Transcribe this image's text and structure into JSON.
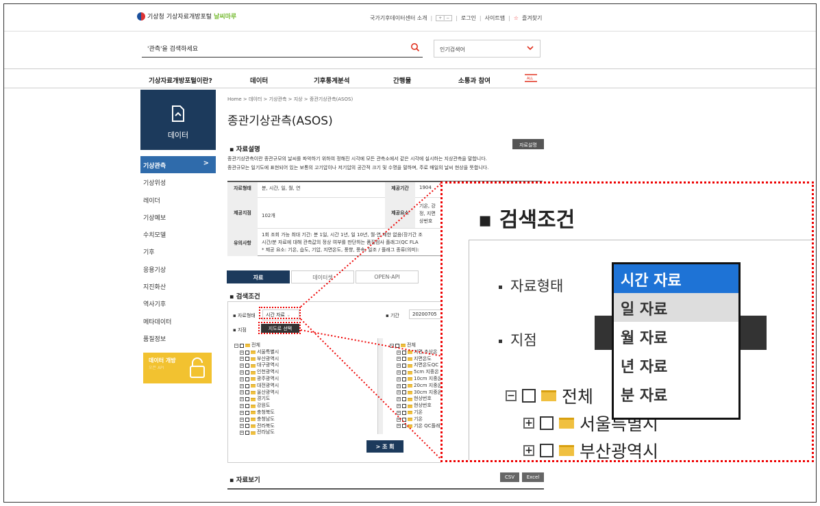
{
  "header": {
    "logo_org": "기상청",
    "logo_text": "기상자료개방포털",
    "logo_sub": "날씨마루",
    "toplinks": [
      "국가기후데이터센터 소개",
      "로그인",
      "사이트맵",
      "즐겨찾기"
    ],
    "search_placeholder": "'관측'을 검색하세요",
    "popular_label": "인기검색어"
  },
  "gnb": {
    "items": [
      "기상자료개방포털이란?",
      "데이터",
      "기후통계분석",
      "간행물",
      "소통과 참여"
    ],
    "all_label": "ALL"
  },
  "sidebar": {
    "title": "데이터",
    "items": [
      "기상관측",
      "기상위성",
      "레이더",
      "기상예보",
      "수치모델",
      "기후",
      "응용기상",
      "지진화산",
      "역사기후",
      "메타데이터",
      "품질정보"
    ],
    "banner_title": "데이터 개방",
    "banner_sub": "오픈 API"
  },
  "main": {
    "breadcrumb": "Home > 데이터 > 기상관측 > 지상 > 종관기상관측(ASOS)",
    "title": "종관기상관측(ASOS)",
    "desc_title": "자료설명",
    "desc_button": "자료설명",
    "desc_line1": "종관기상관측이란 종관규모의 날씨를 파악하기 위하여 정해진 시각에 모든 관측소에서 같은 시각에 실시하는 지상관측을 말합니다.",
    "desc_line2": "종관규모는 일기도에 표현되어 있는 보통의 고기압이나 저기압의 공간적 크기 및 수명을 말하며, 주로 매일의 날씨 현상을 뜻합니다.",
    "info": {
      "type_label": "자료형태",
      "type_value": "분, 시간, 일, 월, 연",
      "period_label": "제공기간",
      "period_value": "1904",
      "station_label": "제공지점",
      "station_value": "102개",
      "elements_label": "제공요소",
      "elements_value": "기온, 강",
      "elements_value2": "정, 지면",
      "elements_value3": "상번호",
      "note_label": "유의사항",
      "note_line1": "1회 조회 가능 최대 기간: 분 1일, 시간 1년, 일 10년, 월·연 제한 없음(장기간 조",
      "note_line2": "시간/분 자료에 대해 관측값의 정상 여부를 판단하는 품질검사 플래그(QC FLA",
      "note_line3": "* 제공 요소: 기온, 습도, 기압, 지면온도, 풍향, 풍속, 일조 / 플래그 종류(의미):"
    },
    "tabs": [
      "자료",
      "데이터셋",
      "OPEN-API"
    ],
    "search_title": "검색조건",
    "type_label": "자료형태",
    "type_value": "시간 자료",
    "period_label": "기간",
    "period_value": "20200705",
    "station_label": "지점",
    "map_button": "지도로 선택",
    "tree_left": [
      "전체",
      "서울특별시",
      "부산광역시",
      "대구광역시",
      "인천광역시",
      "광주광역시",
      "대전광역시",
      "울산광역시",
      "경기도",
      "강원도",
      "충청북도",
      "충청남도",
      "전라북도",
      "전라남도"
    ],
    "tree_right": [
      "전체",
      "지면,초상온",
      "지면온도",
      "지면온도QC",
      "5cm 지중온",
      "10cm 지중온",
      "20cm 지중온",
      "30cm 지중온",
      "현상번호",
      "현상번호",
      "기온",
      "기온",
      "기온 QC플래그"
    ],
    "query_button": "> 조 회",
    "view_title": "자료보기",
    "csv_button": "CSV",
    "excel_button": "Excel"
  },
  "zoom": {
    "title": "검색조건",
    "type_label": "자료형태",
    "station_label": "지점",
    "options": [
      "시간 자료",
      "일 자료",
      "월 자료",
      "년 자료",
      "분 자료"
    ],
    "tree": [
      "전체",
      "서울특별시",
      "부산광역시"
    ]
  }
}
